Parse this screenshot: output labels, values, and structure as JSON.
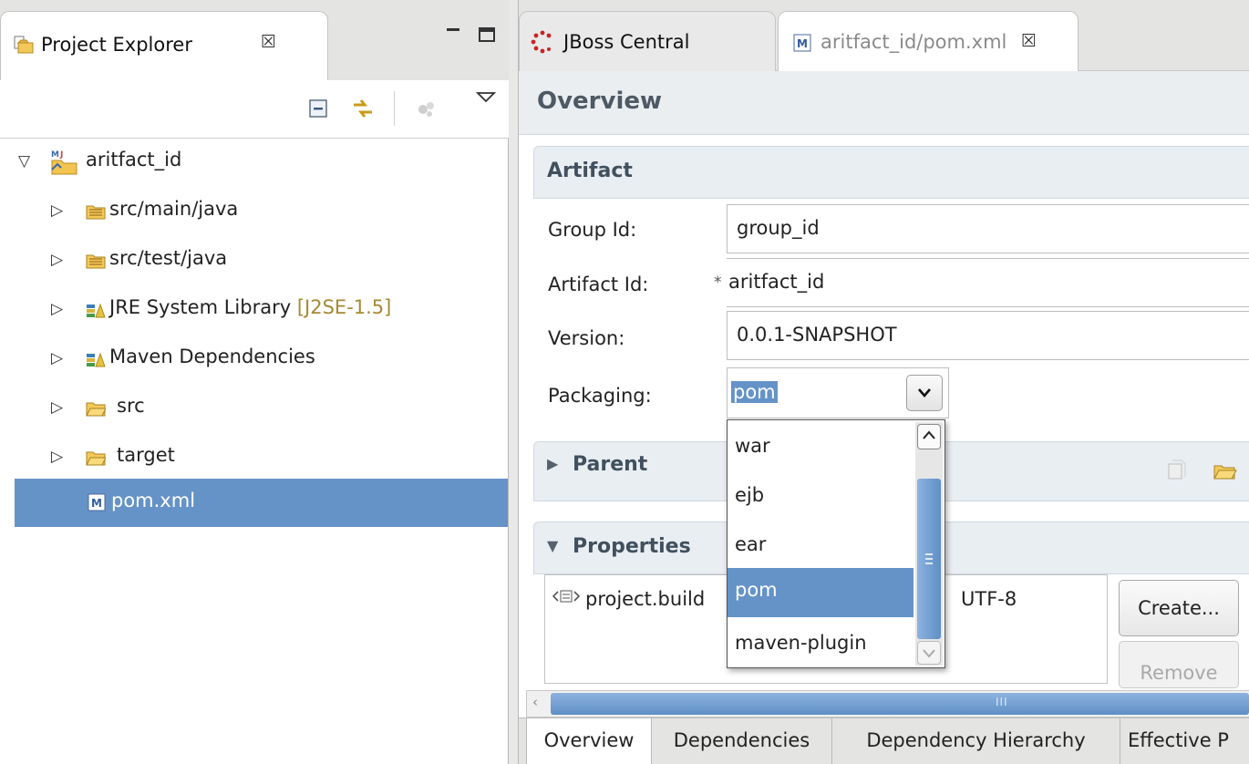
{
  "project_explorer": {
    "tab_title": "Project Explorer",
    "close_glyph": "☒",
    "toolbar_icons": [
      "collapse-all-icon",
      "link-with-editor-icon",
      "focus-active-task-icon",
      "view-menu-icon"
    ],
    "tree": [
      {
        "label": "aritfact_id",
        "icon": "maven-project-icon",
        "expanded": true,
        "level": 0
      },
      {
        "label": "src/main/java",
        "icon": "source-folder-icon",
        "expanded": false,
        "level": 1
      },
      {
        "label": "src/test/java",
        "icon": "source-folder-icon",
        "expanded": false,
        "level": 1
      },
      {
        "label": "JRE System Library",
        "decoration": "[J2SE-1.5]",
        "icon": "library-icon",
        "expanded": false,
        "level": 1
      },
      {
        "label": "Maven Dependencies",
        "icon": "library-icon",
        "expanded": false,
        "level": 1
      },
      {
        "label": "src",
        "icon": "folder-icon",
        "expanded": false,
        "level": 1
      },
      {
        "label": "target",
        "icon": "folder-icon",
        "expanded": false,
        "level": 1
      },
      {
        "label": "pom.xml",
        "icon": "maven-pom-file-icon",
        "selected": true,
        "level": 1
      }
    ]
  },
  "editor": {
    "tabs": [
      {
        "label": "JBoss Central",
        "icon": "jboss-central-icon",
        "active": false
      },
      {
        "label": "aritfact_id/pom.xml",
        "icon": "maven-pom-file-icon",
        "active": true,
        "close_glyph": "☒"
      }
    ],
    "page_title": "Overview",
    "artifact_section": {
      "title": "Artifact",
      "group_id_label": "Group Id:",
      "group_id_value": "group_id",
      "artifact_id_label": "Artifact Id:",
      "required_marker": "*",
      "artifact_id_value": "aritfact_id",
      "version_label": "Version:",
      "version_value": "0.0.1-SNAPSHOT",
      "packaging_label": "Packaging:",
      "packaging_value": "pom"
    },
    "packaging_options": [
      "war",
      "ejb",
      "ear",
      "pom",
      "maven-plugin"
    ],
    "packaging_selected_index": 3,
    "parent_section": {
      "title": "Parent"
    },
    "properties_section": {
      "title": "Properties",
      "row_name": "project.build",
      "row_value": "UTF-8",
      "create_button": "Create...",
      "remove_button": "Remove"
    },
    "hscroll_grip": "III",
    "page_tabs": [
      "Overview",
      "Dependencies",
      "Dependency Hierarchy",
      "Effective P"
    ]
  },
  "colors": {
    "selection": "#6593c8",
    "section_header_bg": "#e9eef3",
    "section_title": "#41505e",
    "jre_decoration": "#a58a33"
  }
}
